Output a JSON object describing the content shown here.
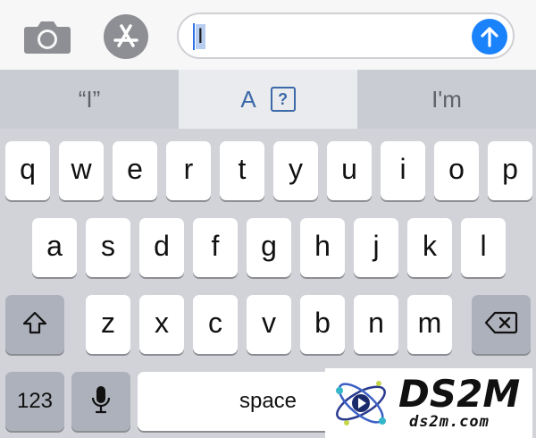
{
  "input_bar": {
    "camera_icon": "camera-icon",
    "apps_icon": "app-store-icon",
    "message_value": "I",
    "send_icon": "arrow-up-icon"
  },
  "suggestions": [
    {
      "label": "“I”"
    },
    {
      "label": "A",
      "badge": "?"
    },
    {
      "label": "I'm"
    }
  ],
  "keyboard": {
    "row1": [
      "q",
      "w",
      "e",
      "r",
      "t",
      "y",
      "u",
      "i",
      "o",
      "p"
    ],
    "row2": [
      "a",
      "s",
      "d",
      "f",
      "g",
      "h",
      "j",
      "k",
      "l"
    ],
    "row3": [
      "z",
      "x",
      "c",
      "v",
      "b",
      "n",
      "m"
    ],
    "numbers_label": "123",
    "space_label": "space",
    "shift_icon": "shift-icon",
    "delete_icon": "delete-icon",
    "mic_icon": "microphone-icon"
  },
  "watermark": {
    "brand": "DS2M",
    "url": "ds2m.com"
  },
  "colors": {
    "accent": "#1a82fb",
    "keyboard_bg": "#d1d3d9",
    "key_bg": "#ffffff",
    "function_key_bg": "#adb1bb"
  }
}
